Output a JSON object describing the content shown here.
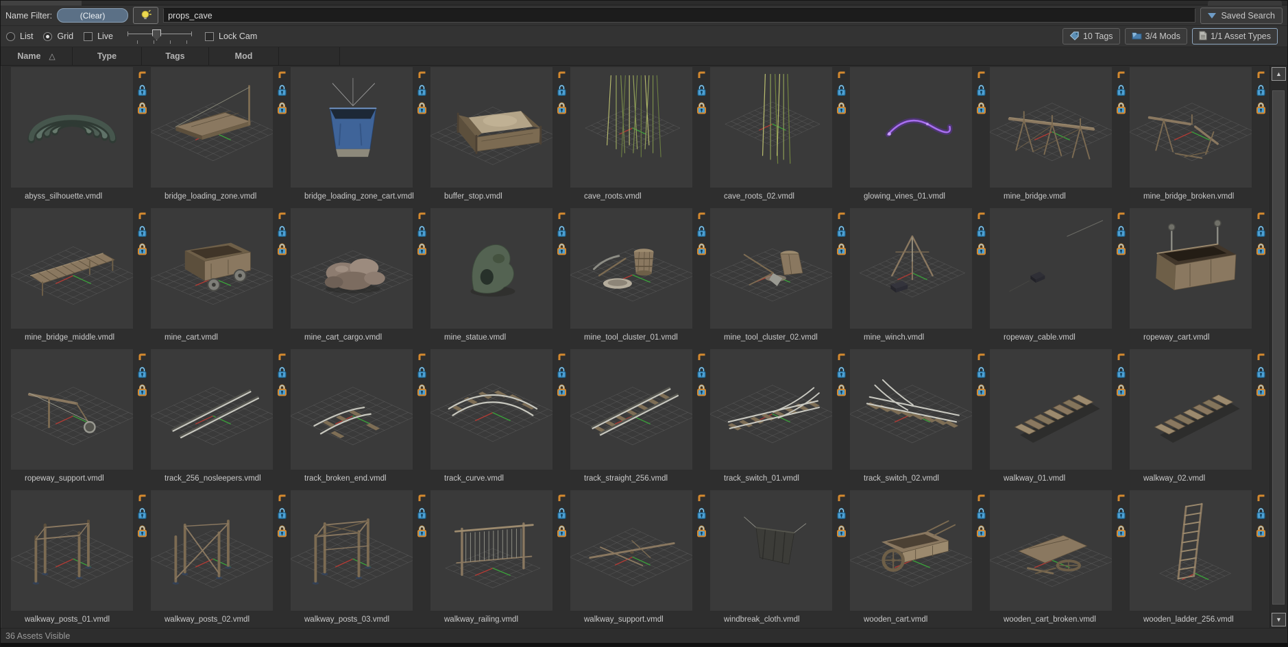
{
  "filter_bar": {
    "label": "Name Filter:",
    "clear_button": "(Clear)",
    "search_value": "props_cave",
    "saved_search_button": "Saved Search"
  },
  "view_bar": {
    "list_option": "List",
    "grid_option": "Grid",
    "selected_option": "Grid",
    "live_checkbox": "Live",
    "lock_cam_checkbox": "Lock Cam",
    "tags_button": "10 Tags",
    "mods_button": "3/4 Mods",
    "asset_types_button": "1/1 Asset Types"
  },
  "table_header": {
    "columns": [
      "Name",
      "Type",
      "Tags",
      "Mod"
    ],
    "sorted_column": "Name",
    "sort_direction": "ascending"
  },
  "icons": {
    "sort_ascending": "△",
    "scroll_up": "▲",
    "scroll_down": "▼"
  },
  "tile_icons": [
    "bookmark-corner",
    "lock",
    "lock-highlighted"
  ],
  "assets": [
    {
      "name": "abyss_silhouette.vmdl",
      "thumb": "arcs"
    },
    {
      "name": "bridge_loading_zone.vmdl",
      "thumb": "platform"
    },
    {
      "name": "bridge_loading_zone_cart.vmdl",
      "thumb": "bucket"
    },
    {
      "name": "buffer_stop.vmdl",
      "thumb": "sandbox"
    },
    {
      "name": "cave_roots.vmdl",
      "thumb": "roots"
    },
    {
      "name": "cave_roots_02.vmdl",
      "thumb": "roots2"
    },
    {
      "name": "glowing_vines_01.vmdl",
      "thumb": "vine"
    },
    {
      "name": "mine_bridge.vmdl",
      "thumb": "trestle"
    },
    {
      "name": "mine_bridge_broken.vmdl",
      "thumb": "trestle_broken"
    },
    {
      "name": "mine_bridge_middle.vmdl",
      "thumb": "plank_bridge"
    },
    {
      "name": "mine_cart.vmdl",
      "thumb": "cart"
    },
    {
      "name": "mine_cart_cargo.vmdl",
      "thumb": "rocks"
    },
    {
      "name": "mine_statue.vmdl",
      "thumb": "statue"
    },
    {
      "name": "mine_tool_cluster_01.vmdl",
      "thumb": "tools"
    },
    {
      "name": "mine_tool_cluster_02.vmdl",
      "thumb": "tools2"
    },
    {
      "name": "mine_winch.vmdl",
      "thumb": "winch"
    },
    {
      "name": "ropeway_cable.vmdl",
      "thumb": "cable"
    },
    {
      "name": "ropeway_cart.vmdl",
      "thumb": "ropeway_cart"
    },
    {
      "name": "ropeway_support.vmdl",
      "thumb": "support"
    },
    {
      "name": "track_256_nosleepers.vmdl",
      "thumb": "rails"
    },
    {
      "name": "track_broken_end.vmdl",
      "thumb": "rails_broken"
    },
    {
      "name": "track_curve.vmdl",
      "thumb": "rail_curve"
    },
    {
      "name": "track_straight_256.vmdl",
      "thumb": "track_straight"
    },
    {
      "name": "track_switch_01.vmdl",
      "thumb": "switch"
    },
    {
      "name": "track_switch_02.vmdl",
      "thumb": "switch2"
    },
    {
      "name": "walkway_01.vmdl",
      "thumb": "walkway"
    },
    {
      "name": "walkway_02.vmdl",
      "thumb": "walkway"
    },
    {
      "name": "walkway_posts_01.vmdl",
      "thumb": "posts"
    },
    {
      "name": "walkway_posts_02.vmdl",
      "thumb": "posts2"
    },
    {
      "name": "walkway_posts_03.vmdl",
      "thumb": "posts3"
    },
    {
      "name": "walkway_railing.vmdl",
      "thumb": "railing"
    },
    {
      "name": "walkway_support.vmdl",
      "thumb": "flat_support"
    },
    {
      "name": "windbreak_cloth.vmdl",
      "thumb": "cloth"
    },
    {
      "name": "wooden_cart.vmdl",
      "thumb": "wood_cart"
    },
    {
      "name": "wooden_cart_broken.vmdl",
      "thumb": "wood_cart_broken"
    },
    {
      "name": "wooden_ladder_256.vmdl",
      "thumb": "ladder"
    }
  ],
  "status_bar": {
    "text": "36 Assets Visible"
  },
  "colors": {
    "accent_orange": "#d4892f",
    "lock_blue": "#4da0d4",
    "clear_button_bg": "#5b7086",
    "bulb_yellow": "#ecd94f",
    "dropdown_blue": "#6f9cc6",
    "tag_icon_blue": "#5d8fb5",
    "folder_icon_blue": "#4a7fae"
  }
}
